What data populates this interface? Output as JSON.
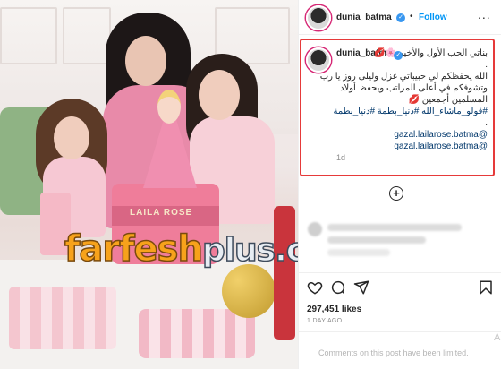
{
  "post": {
    "username": "dunia_batma",
    "follow_label": "Follow",
    "separator": "•",
    "more_label": "...",
    "verified_mark": "✓"
  },
  "caption": {
    "username": "dunia_batma",
    "line1": "بناتي الحب الأول والأخير 🌸💋",
    "dot": ".",
    "line2": "الله يحفظكم لي حبيباتي غزل وليلى روز يا رب وتشوفكم في أعلى المراتب ويحفظ أولاد المسلمين أجمعين 💋",
    "hashtags": "#قولو_ماشاء_الله #دنيا_بطمة #دنيا_بطمة",
    "mention1": "@gazal.lailarose.batma",
    "mention2": "@gazal.lailarose.batma",
    "age": "1d"
  },
  "photo": {
    "cake_text": "LAILA ROSE",
    "watermark_main": "farfesh",
    "watermark_suffix": "plus.com"
  },
  "actions": {
    "likes": "297,451 likes",
    "time": "1 DAY AGO",
    "comments_limited": "Comments on this post have been limited.",
    "ad_letter": "A",
    "add_label": "+"
  },
  "colors": {
    "follow": "#0095f6",
    "highlight_border": "#e63a3a",
    "watermark_orange": "#f7a21b"
  },
  "icons": [
    "verified-badge-icon",
    "more-options-icon",
    "add-comment-icon",
    "like-heart-icon",
    "comment-icon",
    "share-icon",
    "save-bookmark-icon"
  ]
}
